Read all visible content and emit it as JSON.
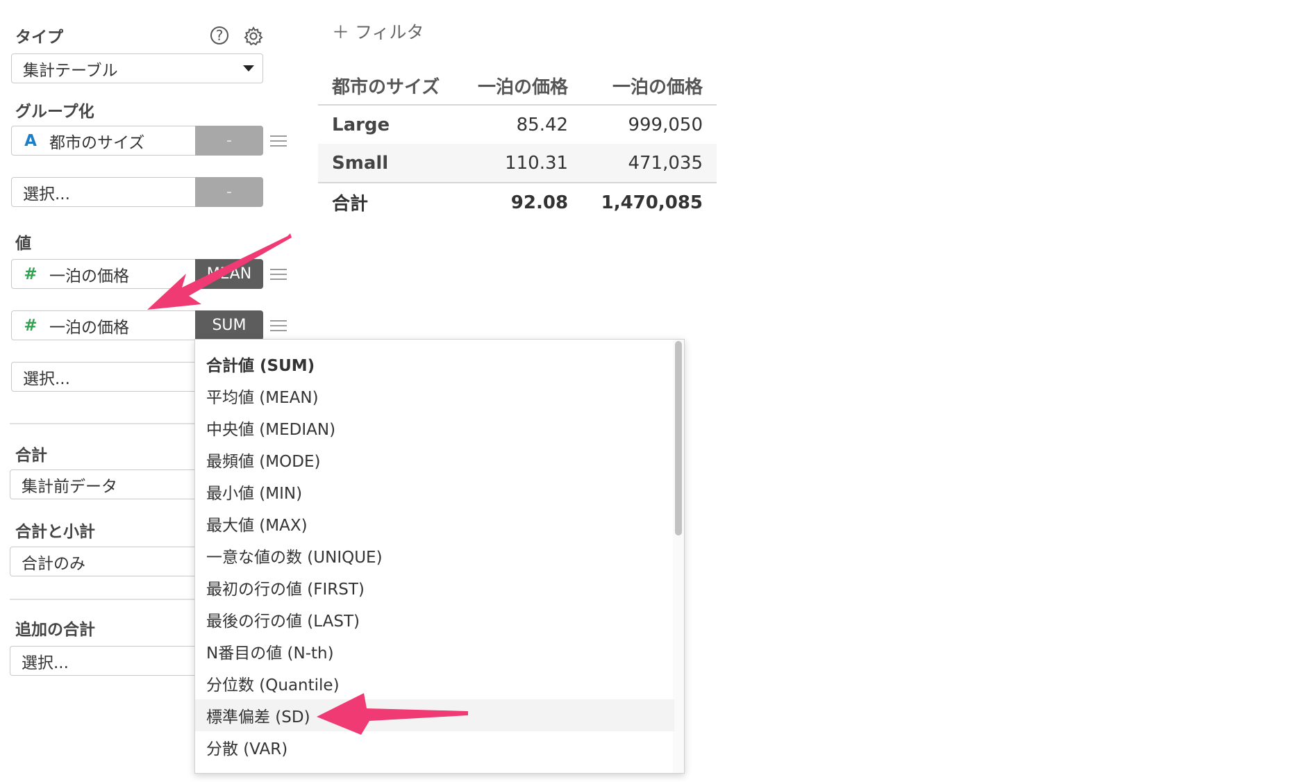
{
  "sidebar": {
    "type_label": "タイプ",
    "type_select": "集計テーブル",
    "group_label": "グループ化",
    "group_field": "都市のサイズ",
    "group_field_icon": "A",
    "group_field_btn": "-",
    "group_select_placeholder": "選択...",
    "group_select_btn": "-",
    "value_label": "値",
    "value_field_1": "一泊の価格",
    "value_field_1_agg": "MEAN",
    "value_field_2": "一泊の価格",
    "value_field_2_agg": "SUM",
    "num_icon": "#",
    "value_select_placeholder": "選択...",
    "total_label": "合計",
    "total_select": "集計前データ",
    "subtotal_label": "合計と小計",
    "subtotal_select": "合計のみ",
    "extra_total_label": "追加の合計",
    "extra_total_select": "選択..."
  },
  "header": {
    "help_icon": "question-circle-icon",
    "settings_icon": "gear-icon",
    "help_glyph": "?",
    "add_filter": "＋ フィルタ"
  },
  "table": {
    "columns": [
      "都市のサイズ",
      "一泊の価格",
      "一泊の価格"
    ],
    "rows": [
      [
        "Large",
        "85.42",
        "999,050"
      ],
      [
        "Small",
        "110.31",
        "471,035"
      ]
    ],
    "total": [
      "合計",
      "92.08",
      "1,470,085"
    ]
  },
  "dropdown": {
    "items": [
      "合計値 (SUM)",
      "平均値 (MEAN)",
      "中央値 (MEDIAN)",
      "最頻値 (MODE)",
      "最小値 (MIN)",
      "最大値 (MAX)",
      "一意な値の数 (UNIQUE)",
      "最初の行の値 (FIRST)",
      "最後の行の値 (LAST)",
      "N番目の値 (N-th)",
      "分位数 (Quantile)",
      "標準偏差 (SD)",
      "分散 (VAR)"
    ],
    "selected_index": 0,
    "hover_index": 11
  },
  "colors": {
    "annotation_arrow": "#f03a73",
    "string_icon": "#1e7fc6",
    "number_icon": "#2ea44f"
  }
}
